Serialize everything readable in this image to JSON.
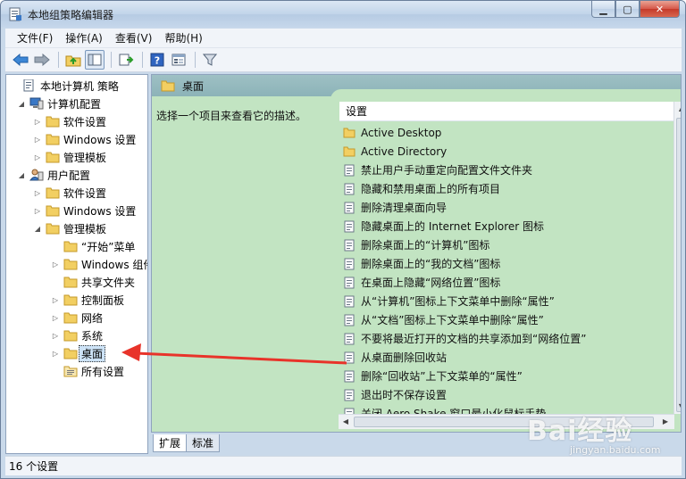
{
  "window": {
    "title": "本地组策略编辑器"
  },
  "menu": [
    "文件(F)",
    "操作(A)",
    "查看(V)",
    "帮助(H)"
  ],
  "toolbar": {
    "buttons": [
      "back-arrow-icon",
      "forward-arrow-icon",
      "up-folder-icon",
      "show-hide-tree-icon",
      "export-list-icon",
      "help-icon",
      "properties-icon",
      "filter-icon"
    ]
  },
  "tree": [
    {
      "label": "本地计算机 策略",
      "icon": "policy-icon",
      "expander": ""
    },
    {
      "label": "计算机配置",
      "icon": "computer-icon",
      "expander": "◢"
    },
    {
      "label": "软件设置",
      "icon": "folder-icon",
      "expander": "▷"
    },
    {
      "label": "Windows 设置",
      "icon": "folder-icon",
      "expander": "▷"
    },
    {
      "label": "管理模板",
      "icon": "folder-icon",
      "expander": "▷"
    },
    {
      "label": "用户配置",
      "icon": "user-icon",
      "expander": "◢"
    },
    {
      "label": "软件设置",
      "icon": "folder-icon",
      "expander": "▷"
    },
    {
      "label": "Windows 设置",
      "icon": "folder-icon",
      "expander": "▷"
    },
    {
      "label": "管理模板",
      "icon": "folder-icon",
      "expander": "◢"
    },
    {
      "label": "“开始”菜单",
      "icon": "folder-icon",
      "expander": ""
    },
    {
      "label": "Windows 组件",
      "icon": "folder-icon",
      "expander": "▷"
    },
    {
      "label": "共享文件夹",
      "icon": "folder-icon",
      "expander": ""
    },
    {
      "label": "控制面板",
      "icon": "folder-icon",
      "expander": "▷"
    },
    {
      "label": "网络",
      "icon": "folder-icon",
      "expander": "▷"
    },
    {
      "label": "系统",
      "icon": "folder-icon",
      "expander": "▷"
    },
    {
      "label": "桌面",
      "icon": "folder-icon",
      "expander": "▷",
      "selected": true
    },
    {
      "label": "所有设置",
      "icon": "all-settings-icon",
      "expander": ""
    }
  ],
  "right": {
    "header": "桌面",
    "description": "选择一个项目来查看它的描述。",
    "column_header": "设置",
    "items": [
      {
        "label": "Active Desktop",
        "icon": "folder-icon"
      },
      {
        "label": "Active Directory",
        "icon": "folder-icon"
      },
      {
        "label": "禁止用户手动重定向配置文件文件夹",
        "icon": "setting-icon"
      },
      {
        "label": "隐藏和禁用桌面上的所有项目",
        "icon": "setting-icon"
      },
      {
        "label": "删除清理桌面向导",
        "icon": "setting-icon"
      },
      {
        "label": "隐藏桌面上的 Internet Explorer 图标",
        "icon": "setting-icon"
      },
      {
        "label": "删除桌面上的“计算机”图标",
        "icon": "setting-icon"
      },
      {
        "label": "删除桌面上的“我的文档”图标",
        "icon": "setting-icon"
      },
      {
        "label": "在桌面上隐藏“网络位置”图标",
        "icon": "setting-icon"
      },
      {
        "label": "从“计算机”图标上下文菜单中删除“属性”",
        "icon": "setting-icon"
      },
      {
        "label": "从“文档”图标上下文菜单中删除“属性”",
        "icon": "setting-icon"
      },
      {
        "label": "不要将最近打开的文档的共享添加到“网络位置”",
        "icon": "setting-icon"
      },
      {
        "label": "从桌面删除回收站",
        "icon": "setting-icon"
      },
      {
        "label": "删除“回收站”上下文菜单的“属性”",
        "icon": "setting-icon"
      },
      {
        "label": "退出时不保存设置",
        "icon": "setting-icon"
      },
      {
        "label": "关闭 Aero Shake 窗口最小化鼠标手势",
        "icon": "setting-icon"
      }
    ]
  },
  "tabs": [
    "扩展",
    "标准"
  ],
  "status": "16 个设置",
  "watermark": {
    "main": "Bai经验",
    "sub": "jingyan.baidu.com"
  },
  "colors": {
    "accent_green": "#c2e4c2",
    "arrow_red": "#e8332a",
    "header_teal": "#9ec0c4"
  }
}
